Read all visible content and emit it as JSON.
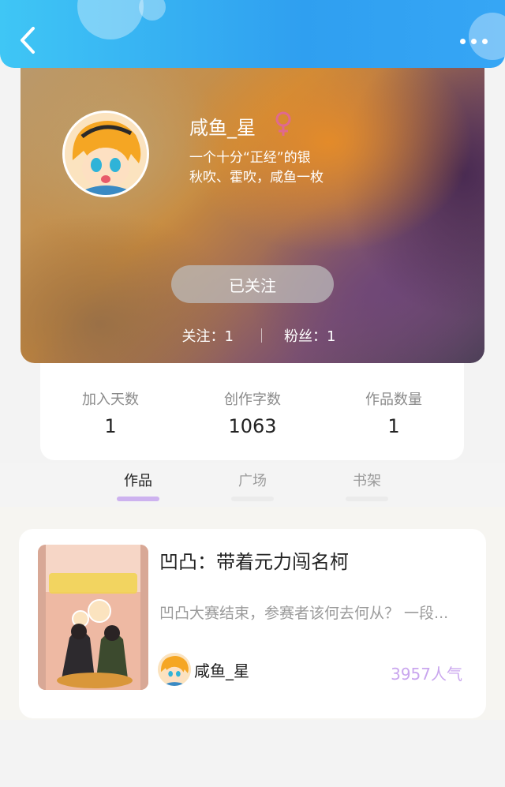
{
  "profile": {
    "username": "咸鱼_星",
    "gender_icon": "female-icon",
    "bio_line1": "一个十分“正经”的银",
    "bio_line2": "秋吹、霍吹，咸鱼一枚",
    "follow_button": "已关注",
    "following": "关注：1",
    "fans": "粉丝：1"
  },
  "stats": [
    {
      "label": "加入天数",
      "value": "1"
    },
    {
      "label": "创作字数",
      "value": "1063"
    },
    {
      "label": "作品数量",
      "value": "1"
    }
  ],
  "tabs": [
    {
      "label": "作品",
      "active": true
    },
    {
      "label": "广场",
      "active": false
    },
    {
      "label": "书架",
      "active": false
    }
  ],
  "work": {
    "title": "凹凸：带着元力闯名柯",
    "description": "凹凸大赛结束，参赛者该何去何从？ 一段...",
    "author": "咸鱼_星",
    "popularity": "3957人气"
  },
  "colors": {
    "topbar": "#2f9ff0",
    "tab_indicator": "#cdb2ef",
    "popularity": "#c9a6ee",
    "female_icon": "#e0698f"
  }
}
